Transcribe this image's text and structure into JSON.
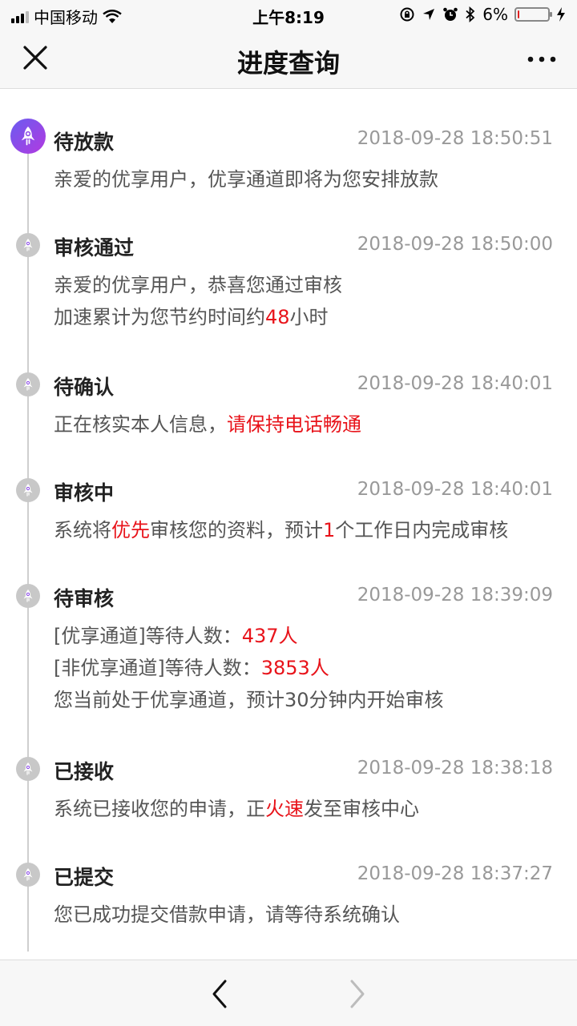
{
  "status_bar": {
    "carrier": "中国移动",
    "time": "上午8:19",
    "battery_percent": "6%",
    "battery_level": 0.06
  },
  "nav": {
    "title": "进度查询"
  },
  "steps": [
    {
      "title": "待放款",
      "time": "2018-09-28 18:50:51",
      "lines": [
        [
          "亲爱的优享用户，优享通道即将为您安排放款"
        ]
      ]
    },
    {
      "title": "审核通过",
      "time": "2018-09-28 18:50:00",
      "lines": [
        [
          "亲爱的优享用户，恭喜您通过审核"
        ],
        [
          "加速累计为您节约时间约",
          "48",
          "小时"
        ]
      ]
    },
    {
      "title": "待确认",
      "time": "2018-09-28 18:40:01",
      "lines": [
        [
          "正在核实本人信息，",
          "请保持电话畅通"
        ]
      ]
    },
    {
      "title": "审核中",
      "time": "2018-09-28 18:40:01",
      "lines": [
        [
          "系统将",
          "优先",
          "审核您的资料，预计",
          "1",
          "个工作日内完成审核"
        ]
      ]
    },
    {
      "title": "待审核",
      "time": "2018-09-28 18:39:09",
      "lines": [
        [
          "[优享通道]等待人数：",
          "437人"
        ],
        [
          "[非优享通道]等待人数：",
          "3853人"
        ],
        [
          "您当前处于优享通道，预计30分钟内开始审核"
        ]
      ]
    },
    {
      "title": "已接收",
      "time": "2018-09-28 18:38:18",
      "lines": [
        [
          "系统已接收您的申请，正",
          "火速",
          "发至审核中心"
        ]
      ]
    },
    {
      "title": "已提交",
      "time": "2018-09-28 18:37:27",
      "lines": [
        [
          "您已成功提交借款申请，请等待系统确认"
        ]
      ]
    }
  ],
  "icons": {
    "close": "close-icon",
    "more": "more-icon",
    "back": "chevron-left-icon",
    "forward": "chevron-right-icon",
    "step": "rocket-icon"
  },
  "colors": {
    "highlight": "#e8131a",
    "active_node": "#8a48e8",
    "inactive_node": "#c8c8c8"
  }
}
